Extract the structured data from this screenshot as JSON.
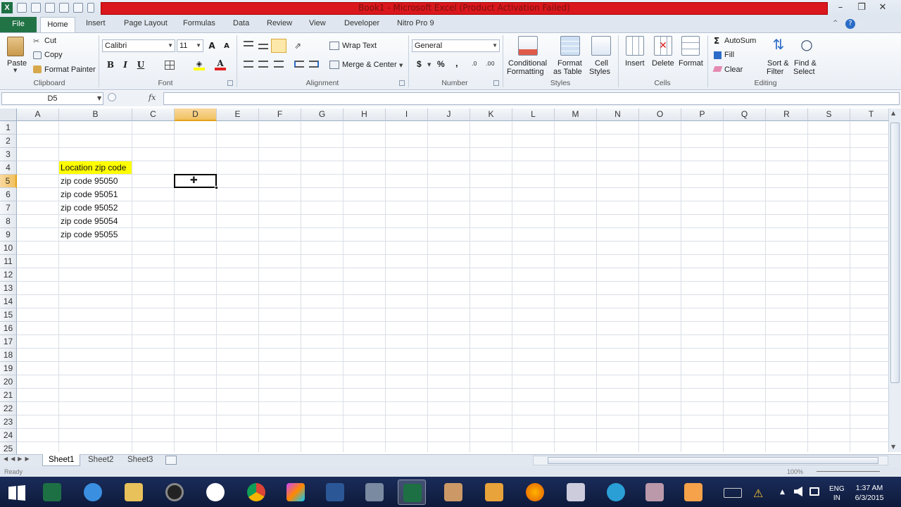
{
  "title": "Book1 - Microsoft Excel (Product Activation Failed)",
  "tabs": [
    "File",
    "Home",
    "Insert",
    "Page Layout",
    "Formulas",
    "Data",
    "Review",
    "View",
    "Developer",
    "Nitro Pro 9"
  ],
  "clipboard": {
    "paste": "Paste",
    "cut": "Cut",
    "copy": "Copy",
    "format_painter": "Format Painter",
    "label": "Clipboard"
  },
  "font": {
    "name": "Calibri",
    "size": "11",
    "label": "Font"
  },
  "alignment": {
    "wrap": "Wrap Text",
    "merge": "Merge & Center",
    "label": "Alignment"
  },
  "number": {
    "format": "General",
    "currency": "$",
    "percent": "%",
    "comma": ",",
    "label": "Number"
  },
  "styles": {
    "cond1": "Conditional",
    "cond2": "Formatting",
    "fmt1": "Format",
    "fmt2": "as Table",
    "cell1": "Cell",
    "cell2": "Styles",
    "label": "Styles"
  },
  "cells": {
    "insert": "Insert",
    "delete": "Delete",
    "format": "Format",
    "label": "Cells"
  },
  "editing": {
    "autosum": "AutoSum",
    "fill": "Fill",
    "clear": "Clear",
    "sort1": "Sort &",
    "sort2": "Filter",
    "find1": "Find &",
    "find2": "Select",
    "label": "Editing"
  },
  "namebox": "D5",
  "fx": "fx",
  "columns": [
    "A",
    "B",
    "C",
    "D",
    "E",
    "F",
    "G",
    "H",
    "I",
    "J",
    "K",
    "L",
    "M",
    "N",
    "O",
    "P",
    "Q",
    "R",
    "S",
    "T"
  ],
  "rows": [
    "1",
    "2",
    "3",
    "4",
    "5",
    "6",
    "7",
    "8",
    "9",
    "10",
    "11",
    "12",
    "13",
    "14",
    "15",
    "16",
    "17",
    "18",
    "19",
    "20",
    "21",
    "22",
    "23",
    "24",
    "25"
  ],
  "cell_values": {
    "B4": "Location zip code",
    "B5": "zip code 95050",
    "B6": "zip code 95051",
    "B7": "zip code 95052",
    "B8": "zip code 95054",
    "B9": "zip code 95055"
  },
  "selected_cell": "D5",
  "sheets": [
    "Sheet1",
    "Sheet2",
    "Sheet3"
  ],
  "status": {
    "ready": "Ready",
    "zoom": "100%"
  },
  "taskbar": {
    "lang1": "ENG",
    "lang2": "IN",
    "time": "1:37 AM",
    "date": "6/3/2015"
  },
  "colors": {
    "highlight": "#ffff00",
    "excel_green": "#217346",
    "titlebar_red": "#d9171c"
  }
}
